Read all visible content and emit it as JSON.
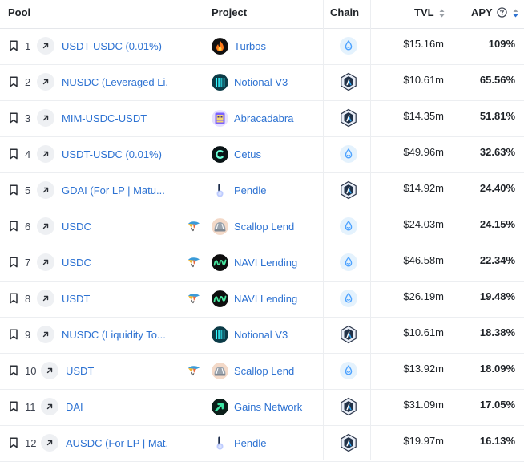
{
  "colors": {
    "link": "#2d72d2",
    "sort_active": "#2d72d2",
    "sort_inactive": "#9aa0a6",
    "divider": "#eceef1"
  },
  "header": {
    "pool": "Pool",
    "project": "Project",
    "chain": "Chain",
    "tvl": "TVL",
    "apy": "APY"
  },
  "rows": [
    {
      "rank": "1",
      "pool": "USDT-USDC (0.01%)",
      "project": "Turbos",
      "project_icon": "turbos-logo-icon",
      "chain": "sui",
      "tvl": "$15.16m",
      "apy": "109%",
      "flag": false
    },
    {
      "rank": "2",
      "pool": "NUSDC (Leveraged Li.",
      "project": "Notional V3",
      "project_icon": "notional-logo-icon",
      "chain": "arbitrum",
      "tvl": "$10.61m",
      "apy": "65.56%",
      "flag": false
    },
    {
      "rank": "3",
      "pool": "MIM-USDC-USDT",
      "project": "Abracadabra",
      "project_icon": "abracadabra-logo-icon",
      "chain": "arbitrum",
      "tvl": "$14.35m",
      "apy": "51.81%",
      "flag": false
    },
    {
      "rank": "4",
      "pool": "USDT-USDC (0.01%)",
      "project": "Cetus",
      "project_icon": "cetus-logo-icon",
      "chain": "sui",
      "tvl": "$49.96m",
      "apy": "32.63%",
      "flag": false
    },
    {
      "rank": "5",
      "pool": "GDAI (For LP | Matu...",
      "project": "Pendle",
      "project_icon": "pendle-logo-icon",
      "chain": "arbitrum",
      "tvl": "$14.92m",
      "apy": "24.40%",
      "flag": false
    },
    {
      "rank": "6",
      "pool": "USDC",
      "project": "Scallop Lend",
      "project_icon": "scallop-logo-icon",
      "chain": "sui",
      "tvl": "$24.03m",
      "apy": "24.15%",
      "flag": true
    },
    {
      "rank": "7",
      "pool": "USDC",
      "project": "NAVI Lending",
      "project_icon": "navi-logo-icon",
      "chain": "sui",
      "tvl": "$46.58m",
      "apy": "22.34%",
      "flag": true
    },
    {
      "rank": "8",
      "pool": "USDT",
      "project": "NAVI Lending",
      "project_icon": "navi-logo-icon",
      "chain": "sui",
      "tvl": "$26.19m",
      "apy": "19.48%",
      "flag": true
    },
    {
      "rank": "9",
      "pool": "NUSDC (Liquidity To...",
      "project": "Notional V3",
      "project_icon": "notional-logo-icon",
      "chain": "arbitrum",
      "tvl": "$10.61m",
      "apy": "18.38%",
      "flag": false
    },
    {
      "rank": "10",
      "pool": "USDT",
      "project": "Scallop Lend",
      "project_icon": "scallop-logo-icon",
      "chain": "sui",
      "tvl": "$13.92m",
      "apy": "18.09%",
      "flag": true
    },
    {
      "rank": "11",
      "pool": "DAI",
      "project": "Gains Network",
      "project_icon": "gains-logo-icon",
      "chain": "arbitrum",
      "tvl": "$31.09m",
      "apy": "17.05%",
      "flag": false
    },
    {
      "rank": "12",
      "pool": "AUSDC (For LP | Mat.",
      "project": "Pendle",
      "project_icon": "pendle-logo-icon",
      "chain": "arbitrum",
      "tvl": "$19.97m",
      "apy": "16.13%",
      "flag": false
    }
  ]
}
